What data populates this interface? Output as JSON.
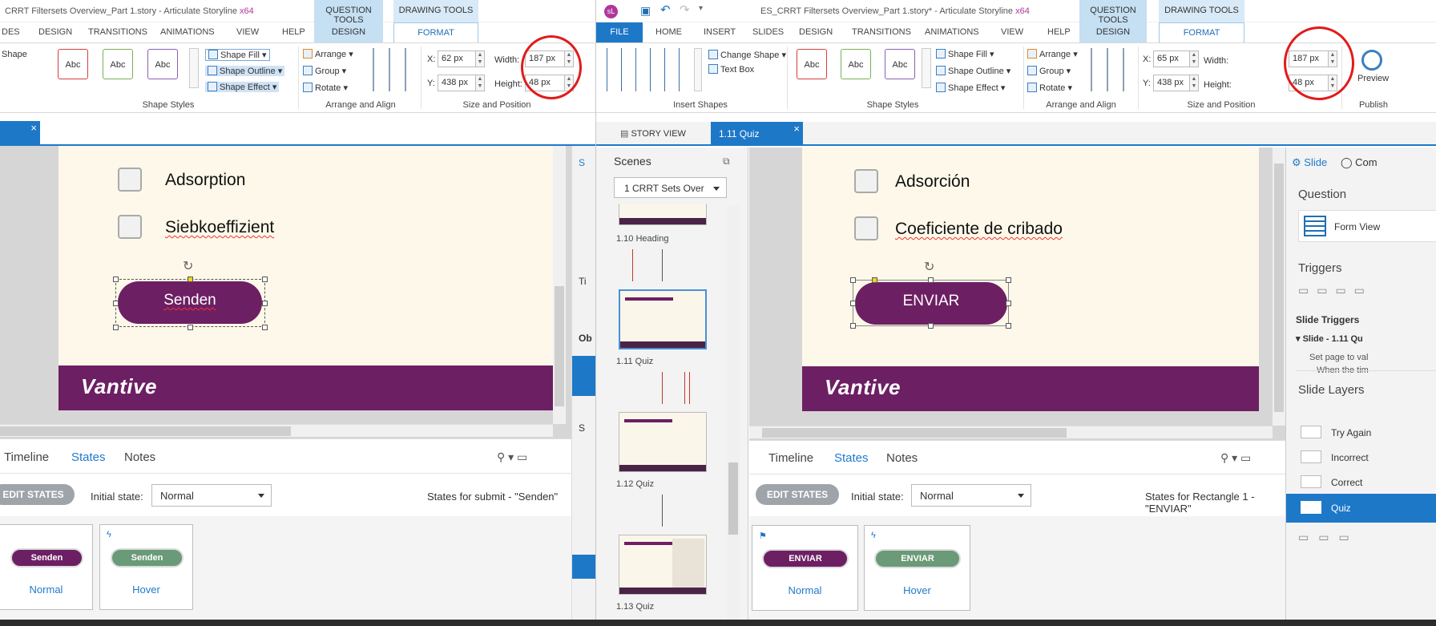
{
  "left": {
    "title": "CRRT Filtersets Overview_Part 1.story - Articulate Storyline",
    "title_suffix": "x64",
    "ctx_question_tools": "QUESTION TOOLS",
    "ctx_drawing_tools": "DRAWING TOOLS",
    "tabs": [
      "DES",
      "DESIGN",
      "TRANSITIONS",
      "ANIMATIONS",
      "VIEW",
      "HELP"
    ],
    "ctx_tab_design": "DESIGN",
    "ctx_tab_format": "FORMAT",
    "ribbon": {
      "shape_label": "Shape",
      "style_sample": "Abc",
      "shape_fill": "Shape Fill",
      "shape_outline": "Shape Outline",
      "shape_effect": "Shape Effect",
      "arrange": "Arrange",
      "group": "Group",
      "rotate": "Rotate",
      "x_label": "X:",
      "x_value": "62 px",
      "y_label": "Y:",
      "y_value": "438 px",
      "width_label": "Width:",
      "width_value": "187 px",
      "height_label": "Height:",
      "height_value": "48 px",
      "grp_shape_styles": "Shape Styles",
      "grp_arrange": "Arrange and Align",
      "grp_size": "Size and Position"
    },
    "slide": {
      "option1": "Adsorption",
      "option2": "Siebkoeffizient",
      "button": "Senden",
      "logo": "Vantive"
    },
    "bottom": {
      "tab_timeline": "Timeline",
      "tab_states": "States",
      "tab_notes": "Notes",
      "edit_states": "EDIT STATES",
      "initial_state_label": "Initial state:",
      "initial_state_value": "Normal",
      "states_for": "States for submit - \"Senden\"",
      "state1_button": "Senden",
      "state1_label": "Normal",
      "state2_button": "Senden",
      "state2_label": "Hover"
    },
    "side_letters": [
      "S",
      "Ti",
      "Ob",
      "S"
    ]
  },
  "right": {
    "avatar": "sL",
    "title": "ES_CRRT Filtersets Overview_Part 1.story* - Articulate Storyline",
    "title_suffix": "x64",
    "ctx_question_tools": "QUESTION TOOLS",
    "ctx_drawing_tools": "DRAWING TOOLS",
    "tab_file": "FILE",
    "tabs": [
      "HOME",
      "INSERT",
      "SLIDES",
      "DESIGN",
      "TRANSITIONS",
      "ANIMATIONS",
      "VIEW",
      "HELP"
    ],
    "ctx_tab_design": "DESIGN",
    "ctx_tab_format": "FORMAT",
    "ribbon": {
      "change_shape": "Change Shape",
      "text_box": "Text Box",
      "insert_shapes": "Insert Shapes",
      "style_sample": "Abc",
      "shape_fill": "Shape Fill",
      "shape_outline": "Shape Outline",
      "shape_effect": "Shape Effect",
      "arrange": "Arrange",
      "group": "Group",
      "rotate": "Rotate",
      "x_label": "X:",
      "x_value": "65 px",
      "y_label": "Y:",
      "y_value": "438 px",
      "width_label": "Width:",
      "width_value": "187 px",
      "height_label": "Height:",
      "height_value": "48 px",
      "preview": "Preview",
      "grp_shape_styles": "Shape Styles",
      "grp_arrange": "Arrange and Align",
      "grp_size": "Size and Position",
      "grp_publish": "Publish"
    },
    "doc_tabs": {
      "story_view": "STORY VIEW",
      "quiz": "1.11 Quiz"
    },
    "scenes": {
      "title": "Scenes",
      "dropdown": "1 CRRT Sets Over",
      "items": [
        {
          "label": "1.10 Heading"
        },
        {
          "label": "1.11 Quiz"
        },
        {
          "label": "1.12 Quiz"
        },
        {
          "label": "1.13 Quiz"
        }
      ]
    },
    "slide": {
      "option1": "Adsorción",
      "option2": "Coeficiente de cribado",
      "button": "ENVIAR",
      "logo": "Vantive"
    },
    "bottom": {
      "tab_timeline": "Timeline",
      "tab_states": "States",
      "tab_notes": "Notes",
      "edit_states": "EDIT STATES",
      "initial_state_label": "Initial state:",
      "initial_state_value": "Normal",
      "states_for": "States for Rectangle 1 - \"ENVIAR\"",
      "state1_button": "ENVIAR",
      "state1_label": "Normal",
      "state2_button": "ENVIAR",
      "state2_label": "Hover"
    },
    "props": {
      "tab_slide": "Slide",
      "tab_comments": "Com",
      "question": "Question",
      "form_view": "Form View",
      "triggers": "Triggers",
      "slide_triggers": "Slide Triggers",
      "slide_item": "Slide - 1.11 Qu",
      "set_page": "Set page to val",
      "when_the": "When the tim",
      "slide_layers": "Slide Layers",
      "layers": [
        "Try Again",
        "Incorrect",
        "Correct",
        "Quiz"
      ]
    }
  },
  "colors": {
    "brand_purple": "#6d1f63",
    "hover_green": "#6a9a77",
    "accent_blue": "#1f7acb",
    "annotation_red": "#e11b1b"
  }
}
